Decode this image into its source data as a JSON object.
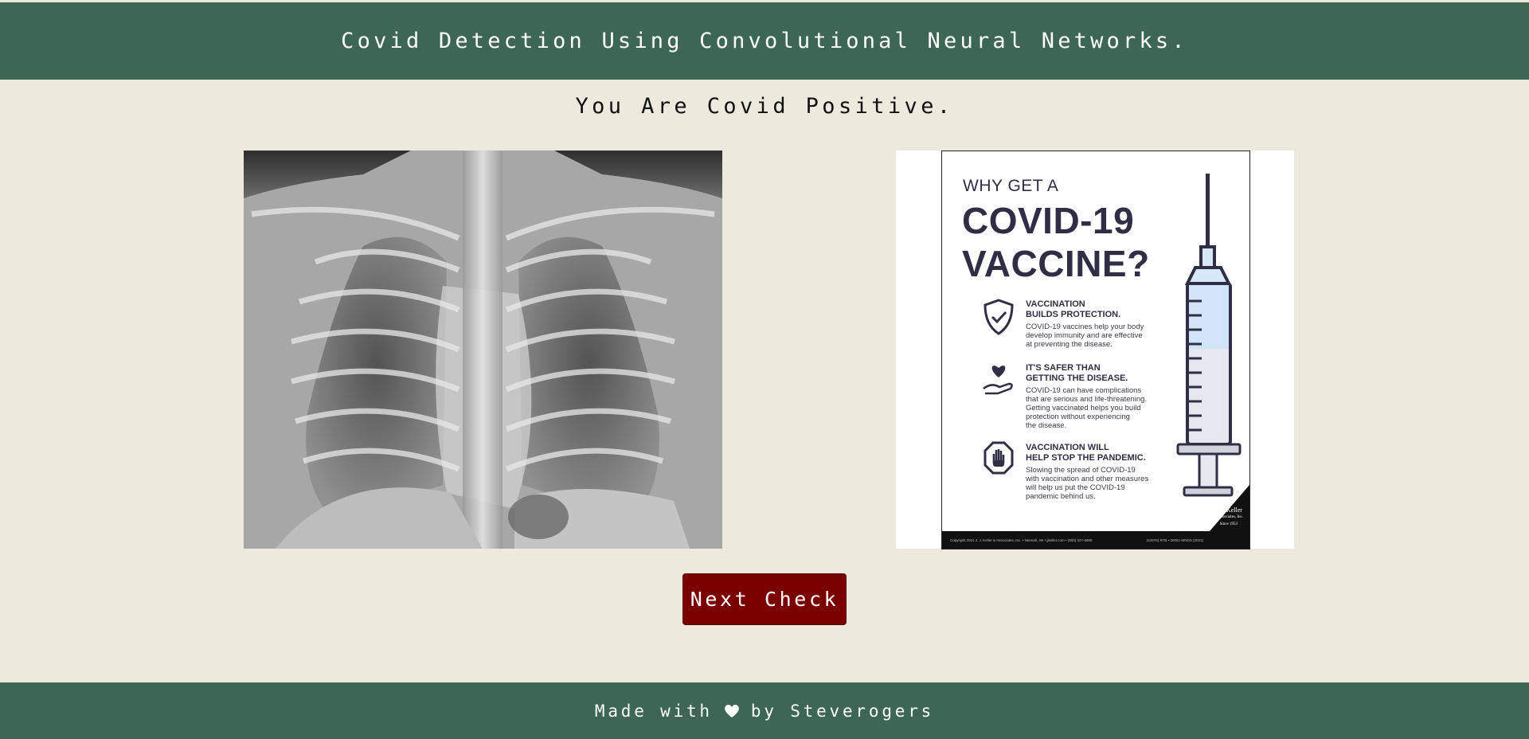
{
  "header": {
    "title": "Covid Detection Using Convolutional Neural Networks."
  },
  "result": {
    "text": "You Are Covid Positive."
  },
  "xray_image": {
    "alt": "chest x-ray"
  },
  "poster": {
    "line1": "WHY GET A",
    "line2": "COVID-19",
    "line3": "VACCINE?",
    "sections": [
      {
        "heading1": "VACCINATION",
        "heading2": "BUILDS PROTECTION.",
        "body": [
          "COVID-19 vaccines help your body",
          "develop immunity and are effective",
          "at preventing the disease."
        ],
        "icon": "shield-check-icon"
      },
      {
        "heading1": "IT'S SAFER THAN",
        "heading2": "GETTING THE DISEASE.",
        "body": [
          "COVID-19 can have complications",
          "that are serious and life-threatening.",
          "Getting vaccinated helps you build",
          "protection without experiencing",
          "the disease."
        ],
        "icon": "heart-hand-icon"
      },
      {
        "heading1": "VACCINATION WILL",
        "heading2": "HELP STOP THE PANDEMIC.",
        "body": [
          "Slowing the spread of COVID-19",
          "with vaccination and other measures",
          "will help us put the COVID-19",
          "pandemic behind us."
        ],
        "icon": "stop-hand-icon"
      }
    ],
    "footer_left": "Copyright 2021 J. J. Keller & Associates, Inc. • Neenah, WI • jjkeller.com • (800) 327-6868",
    "footer_right": "(63976) RTB • 00051-MNDS (2021)",
    "logo_line1": "J. J. Keller",
    "logo_line2": "& Associates, Inc.",
    "logo_line3": "Since 1953"
  },
  "actions": {
    "next_check_label": "Next Check"
  },
  "footer": {
    "made_with": "Made with",
    "by_text": "by Steverogers",
    "heart_icon": "heart-icon"
  },
  "colors": {
    "bar": "#3d6754",
    "background": "#ede9dc",
    "button": "#7a0000",
    "text": "#ffffff"
  }
}
